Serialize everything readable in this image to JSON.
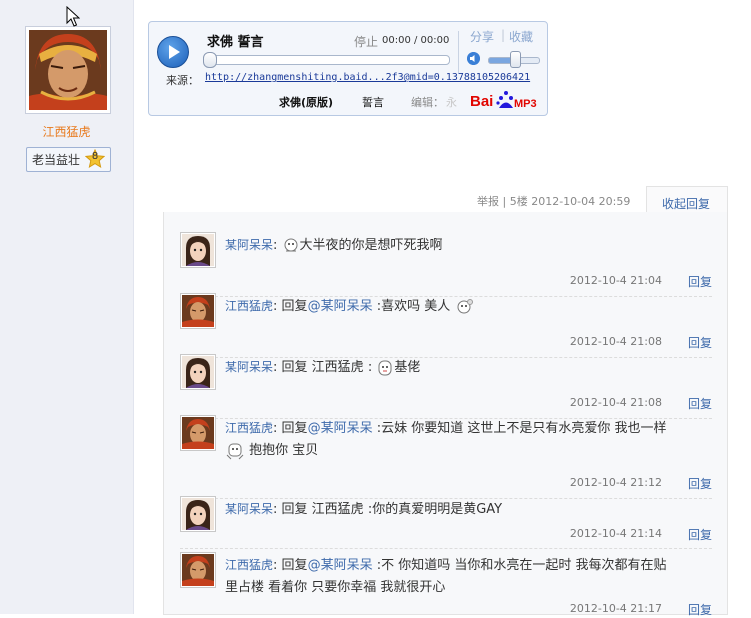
{
  "user": {
    "name": "江西猛虎",
    "level_title": "老当益壮",
    "level_number": "8"
  },
  "player": {
    "title": "求佛  誓言",
    "stop_label": "停止",
    "time": "00:00 / 00:00",
    "share_label": "分享",
    "separator": "|",
    "collect_label": "收藏",
    "source_label": "来源：",
    "source_url": "http://zhangmenshiting.baid...2f3@mid=0.13788105206421",
    "song_name": "求佛(原版)",
    "artist": "誓言",
    "edit_label": "编辑：",
    "edit_value": "永",
    "brand_text": "Bai",
    "brand_suffix": "MP3",
    "progress": 0,
    "volume": 0.5
  },
  "post_meta": {
    "report": "举报",
    "floor": "| 5楼",
    "datetime": "2012-10-04 20:59",
    "collapse_reply": "收起回复"
  },
  "replies": [
    {
      "user": "某阿呆呆",
      "colon": ":",
      "prefix": "",
      "target": "",
      "sep": "",
      "text": "大半夜的你是想吓死我啊",
      "text2": "",
      "emoji": "before",
      "time": "2012-10-4 21:04",
      "reply_label": "回复",
      "avatar": "girl"
    },
    {
      "user": "江西猛虎",
      "colon": ":",
      "prefix": "回复",
      "target": "@某阿呆呆",
      "sep": " :",
      "text": "喜欢吗 美人 ",
      "text2": "",
      "emoji": "after",
      "time": "2012-10-4 21:08",
      "reply_label": "回复",
      "avatar": "tiger"
    },
    {
      "user": "某阿呆呆",
      "colon": ":",
      "prefix": "回复 江西猛虎",
      "target": "",
      "sep": " :",
      "text": "基佬",
      "text2": "",
      "emoji": "before",
      "time": "2012-10-4 21:08",
      "reply_label": "回复",
      "avatar": "girl"
    },
    {
      "user": "江西猛虎",
      "colon": ":",
      "prefix": "回复",
      "target": "@某阿呆呆",
      "sep": " :",
      "text": "云妹 你要知道 这世上不是只有水亮爱你 我也一样",
      "text2": "抱抱你 宝贝",
      "emoji": "line2",
      "time": "2012-10-4 21:12",
      "reply_label": "回复",
      "avatar": "tiger"
    },
    {
      "user": "某阿呆呆",
      "colon": ":",
      "prefix": "回复 江西猛虎",
      "target": "",
      "sep": " :",
      "text": "你的真爱明明是黄GAY",
      "text2": "",
      "emoji": "none",
      "time": "2012-10-4 21:14",
      "reply_label": "回复",
      "avatar": "girl"
    },
    {
      "user": "江西猛虎",
      "colon": ":",
      "prefix": "回复",
      "target": "@某阿呆呆",
      "sep": " :",
      "text": "不 你知道吗 当你和水亮在一起时 我每次都有在贴",
      "text2": "里占楼 看着你 只要你幸福 我就很开心",
      "emoji": "none",
      "time": "2012-10-4 21:17",
      "reply_label": "回复",
      "avatar": "tiger"
    }
  ],
  "colors": {
    "link": "#3e6aab",
    "username_orange": "#e87a1e",
    "sidebar_bg": "#eef0f6"
  }
}
